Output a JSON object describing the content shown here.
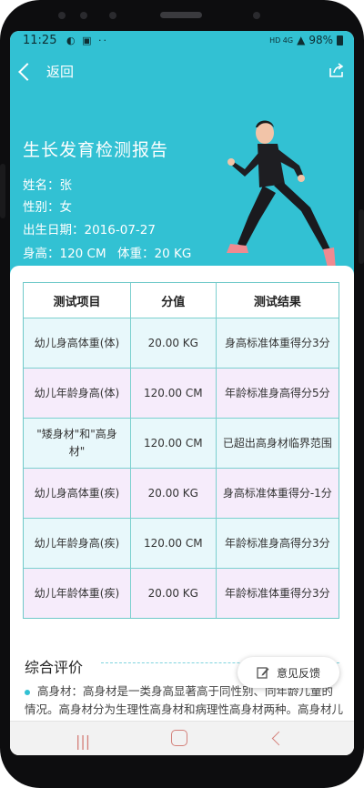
{
  "status_bar": {
    "time": "11:25",
    "network": "HD 4G",
    "battery": "98%"
  },
  "header": {
    "back_label": "返回",
    "title": "生长发育检测报告",
    "name": "姓名：张",
    "gender": "性别：女",
    "birthdate": "出生日期：2016-07-27",
    "height": "身高：120 CM",
    "weight": "体重：20 KG"
  },
  "table": {
    "headers": [
      "测试项目",
      "分值",
      "测试结果"
    ],
    "rows": [
      {
        "item": "幼儿身高体重(体)",
        "value": "20.00 KG",
        "result": "身高标准体重得分3分"
      },
      {
        "item": "幼儿年龄身高(体)",
        "value": "120.00 CM",
        "result": "年龄标准身高得分5分"
      },
      {
        "item": "\"矮身材\"和\"高身材\"",
        "value": "120.00 CM",
        "result": "已超出高身材临界范围"
      },
      {
        "item": "幼儿身高体重(疾)",
        "value": "20.00 KG",
        "result": "身高标准体重得分-1分"
      },
      {
        "item": "幼儿年龄身高(疾)",
        "value": "120.00 CM",
        "result": "年龄标准身高得分3分"
      },
      {
        "item": "幼儿年龄体重(疾)",
        "value": "20.00 KG",
        "result": "年龄标准体重得分3分"
      }
    ]
  },
  "evaluation": {
    "title": "综合评价",
    "text": "高身材：高身材是一类身高显著高于同性别、同年龄儿童的情况。高身材分为生理性高身材和病理性高身材两种。高身材儿童家长在疑问时，应专家咨询或医生帮助。"
  },
  "feedback_label": "意见反馈",
  "colors": {
    "accent": "#32c1d3",
    "row_blue": "#e8f8fb",
    "row_pink": "#f6ecfb",
    "nav_icon": "#d4807a"
  }
}
